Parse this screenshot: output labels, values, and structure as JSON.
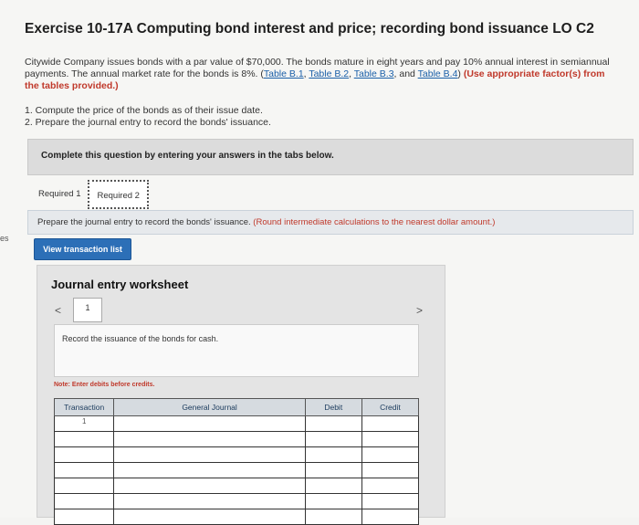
{
  "side_mark": "es",
  "title": "Exercise 10-17A Computing bond interest and price; recording bond issuance LO C2",
  "intro": {
    "text": "Citywide Company issues bonds with a par value of $70,000. The bonds mature in eight years and pay 10% annual interest in semiannual payments. The annual market rate for the bonds is 8%.",
    "open_paren": "(",
    "links": [
      "Table B.1",
      "Table B.2",
      "Table B.3",
      "Table B.4"
    ],
    "and_word": "and",
    "close_paren": ")",
    "instruction": "(Use appropriate factor(s) from the tables provided.)"
  },
  "steps": [
    "1. Compute the price of the bonds as of their issue date.",
    "2. Prepare the journal entry to record the bonds' issuance."
  ],
  "complete_box": "Complete this question by entering your answers in the tabs below.",
  "tabs": [
    "Required 1",
    "Required 2"
  ],
  "prompt": {
    "text": "Prepare the journal entry to record the bonds' issuance.",
    "hint": "(Round intermediate calculations to the nearest dollar amount.)"
  },
  "view_button": "View transaction list",
  "worksheet": {
    "title": "Journal entry worksheet",
    "prev": "<",
    "next": ">",
    "page": "1",
    "record_text": "Record the issuance of the bonds for cash.",
    "note": "Note: Enter debits before credits.",
    "columns": [
      "Transaction",
      "General Journal",
      "Debit",
      "Credit"
    ],
    "first_transaction": "1"
  }
}
